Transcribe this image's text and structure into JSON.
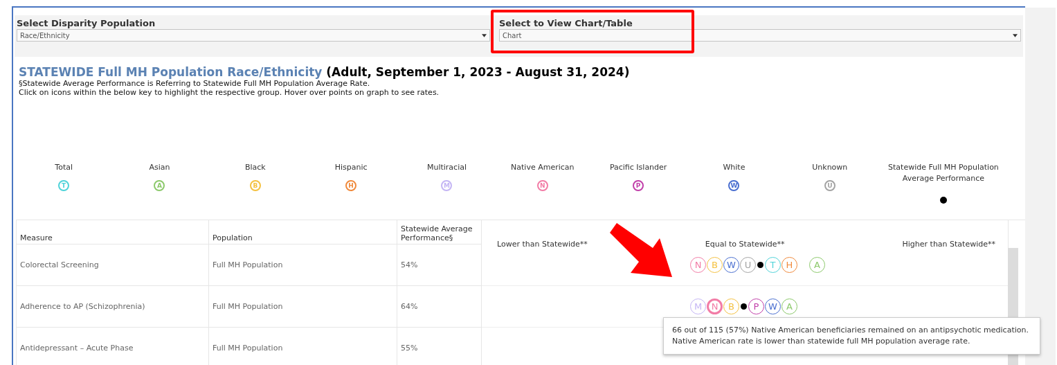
{
  "filters": [
    {
      "label": "Select Disparity Population",
      "value": "Race/Ethnicity"
    },
    {
      "label": "Select to View Chart/Table",
      "value": "Chart"
    }
  ],
  "title": {
    "main": "STATEWIDE Full MH Population Race/Ethnicity",
    "period": "(Adult, September 1, 2023 - August 31, 2024)"
  },
  "notes": [
    "§Statewide Average Performance is Referring to Statewide Full MH Population Average Rate.",
    "Click on icons within the below key to highlight the respective group. Hover over points on graph to see rates."
  ],
  "legend": [
    {
      "label": "Total",
      "letter": "T",
      "color": "#4fd3d9"
    },
    {
      "label": "Asian",
      "letter": "A",
      "color": "#8cc96b"
    },
    {
      "label": "Black",
      "letter": "B",
      "color": "#f4c141"
    },
    {
      "label": "Hispanic",
      "letter": "H",
      "color": "#f08a3c"
    },
    {
      "label": "Multiracial",
      "letter": "M",
      "color": "#c4b5f4"
    },
    {
      "label": "Native American",
      "letter": "N",
      "color": "#f27ca6"
    },
    {
      "label": "Pacific Islander",
      "letter": "P",
      "color": "#c13fa9"
    },
    {
      "label": "White",
      "letter": "W",
      "color": "#4a6fd0"
    },
    {
      "label": "Unknown",
      "letter": "U",
      "color": "#a3a3a3"
    }
  ],
  "average_key": {
    "label": "Statewide Full MH Population Average Performance"
  },
  "table": {
    "columns": [
      "Measure",
      "Population",
      "Statewide Average Performance§"
    ],
    "chart_headers": [
      "Lower than Statewide**",
      "Equal to Statewide**",
      "Higher than Statewide**"
    ],
    "rows": [
      {
        "measure": "Colorectal Screening",
        "population": "Full MH Population",
        "average": "54%",
        "before": [
          {
            "letter": "N",
            "color": "#f27ca6",
            "selected": false
          },
          {
            "letter": "B",
            "color": "#f4c141",
            "selected": false
          },
          {
            "letter": "W",
            "color": "#4a6fd0",
            "selected": false
          },
          {
            "letter": "U",
            "color": "#a3a3a3",
            "selected": false
          }
        ],
        "after": [
          {
            "letter": "T",
            "color": "#4fd3d9",
            "selected": false
          },
          {
            "letter": "H",
            "color": "#f08a3c",
            "selected": false
          }
        ],
        "apart": [
          {
            "letter": "A",
            "color": "#8cc96b",
            "selected": false
          }
        ]
      },
      {
        "measure": "Adherence to AP (Schizophrenia)",
        "population": "Full MH Population",
        "average": "64%",
        "before": [
          {
            "letter": "M",
            "color": "#c4b5f4",
            "selected": false
          },
          {
            "letter": "N",
            "color": "#f27ca6",
            "selected": true
          },
          {
            "letter": "B",
            "color": "#f4c141",
            "selected": false
          }
        ],
        "after": [
          {
            "letter": "P",
            "color": "#c13fa9",
            "selected": false
          },
          {
            "letter": "W",
            "color": "#4a6fd0",
            "selected": false
          },
          {
            "letter": "A",
            "color": "#8cc96b",
            "selected": false
          }
        ],
        "apart": []
      },
      {
        "measure": "Antidepressant – Acute Phase",
        "population": "Full MH Population",
        "average": "55%",
        "before": [],
        "after": [],
        "apart": []
      }
    ]
  },
  "tooltip": {
    "lines": [
      "66 out of 115 (57%) Native American beneficiaries remained on an antipsychotic medication.",
      "Native American rate is lower than statewide full MH population average rate."
    ]
  }
}
